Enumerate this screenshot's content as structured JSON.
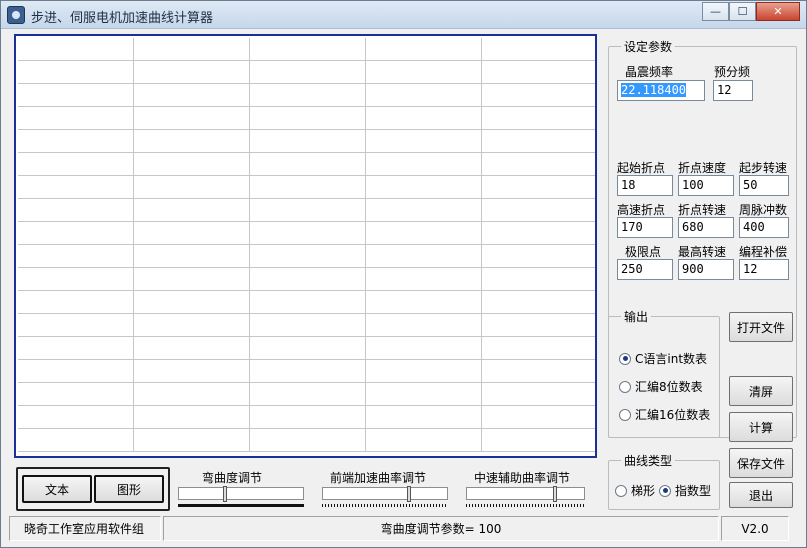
{
  "window": {
    "title": "步进、伺服电机加速曲线计算器",
    "minimize_icon": "minimize-icon",
    "maximize_icon": "maximize-icon",
    "close_icon": "close-icon",
    "minimize_glyph": "—",
    "maximize_glyph": "☐",
    "close_glyph": "✕"
  },
  "settings": {
    "group_label": "设定参数",
    "crystal_label": "晶震频率",
    "crystal_value": "22.118400",
    "prescale_label": "预分频",
    "prescale_value": "12",
    "fields": [
      {
        "label": "起始折点",
        "value": "18"
      },
      {
        "label": "折点速度",
        "value": "100"
      },
      {
        "label": "起步转速",
        "value": "50"
      },
      {
        "label": "高速折点",
        "value": "170"
      },
      {
        "label": "折点转速",
        "value": "680"
      },
      {
        "label": "周脉冲数",
        "value": "400"
      },
      {
        "label": "极限点",
        "value": "250"
      },
      {
        "label": "最高转速",
        "value": "900"
      },
      {
        "label": "编程补偿",
        "value": "12"
      }
    ]
  },
  "output": {
    "group_label": "输出",
    "options": [
      {
        "label": "C语言int数表",
        "selected": true
      },
      {
        "label": "汇编8位数表",
        "selected": false
      },
      {
        "label": "汇编16位数表",
        "selected": false
      }
    ]
  },
  "curve_type": {
    "group_label": "曲线类型",
    "options": [
      {
        "label": "梯形",
        "selected": false
      },
      {
        "label": "指数型",
        "selected": true
      }
    ]
  },
  "buttons": {
    "open_file": "打开文件",
    "clear": "清屏",
    "calculate": "计算",
    "save_file": "保存文件",
    "exit": "退出",
    "text": "文本",
    "graph": "图形"
  },
  "sliders": [
    {
      "label": "弯曲度调节",
      "position": 0.37
    },
    {
      "label": "前端加速曲率调节",
      "position": 0.7
    },
    {
      "label": "中速辅助曲率调节",
      "position": 0.76
    }
  ],
  "status": {
    "org": "晓奇工作室应用软件组",
    "param": "弯曲度调节参数= 100",
    "version": "V2.0"
  },
  "table": {
    "columns": 5,
    "rows": 18
  }
}
